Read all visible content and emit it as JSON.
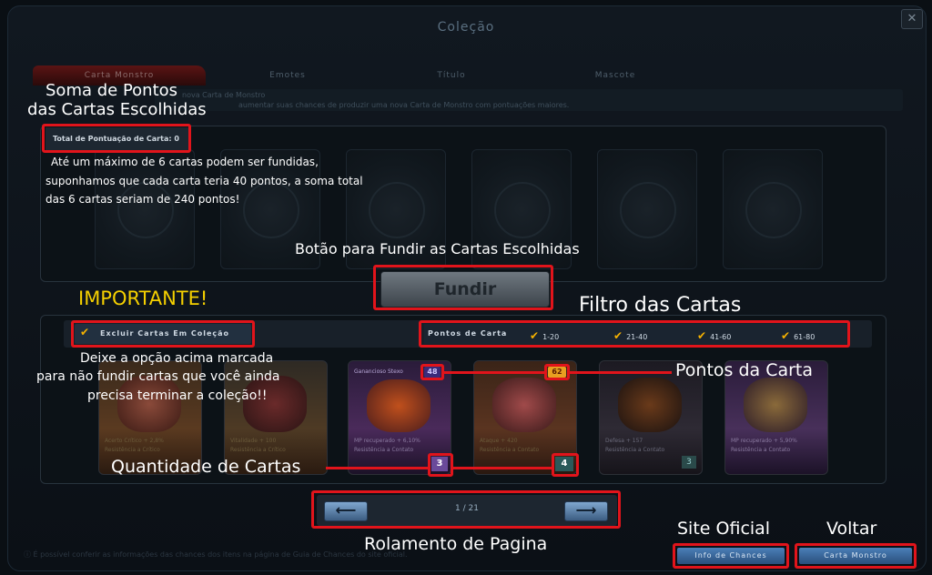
{
  "window": {
    "title": "Coleção"
  },
  "tabs": [
    "Carta Monstro",
    "Emotes",
    "Título",
    "Mascote"
  ],
  "info_strip": {
    "title": "nova Carta de Monstro",
    "text": "aumentar suas chances de produzir uma nova Carta de Monstro com pontuações maiores."
  },
  "score": {
    "label": "Total de Pontuação de Carta: 0"
  },
  "fuse_button": {
    "label": "Fundir"
  },
  "exclude_filter": {
    "label": "Excluir Cartas Em Coleção",
    "checked": true
  },
  "points_filter": {
    "label": "Pontos de Carta",
    "options": [
      {
        "label": "1-20",
        "checked": true
      },
      {
        "label": "21-40",
        "checked": true
      },
      {
        "label": "41-60",
        "checked": true
      },
      {
        "label": "61-80",
        "checked": true
      }
    ]
  },
  "cards": [
    {
      "name": "",
      "stat": "Acerto Crítico + 2,8%",
      "stat2": "Resistência a Crítico",
      "badge": "",
      "qty": ""
    },
    {
      "name": "",
      "stat": "Vitalidade + 100",
      "stat2": "Resistência a Crítico",
      "badge": "",
      "qty": ""
    },
    {
      "name": "Ganancioso Stexo",
      "stat": "MP recuperado + 6,10%",
      "stat2": "Resistência a Contato",
      "badge": "48",
      "qty": "3"
    },
    {
      "name": "",
      "stat": "Ataque + 420",
      "stat2": "Resistência a Contato",
      "badge": "62",
      "qty": "4"
    },
    {
      "name": "",
      "stat": "Defesa + 157",
      "stat2": "Resistência a Contato",
      "badge": "",
      "qty": "3"
    },
    {
      "name": "",
      "stat": "MP recuperado + 5,90%",
      "stat2": "Resistência a Contato",
      "badge": "",
      "qty": ""
    }
  ],
  "pagination": {
    "text": "1 / 21"
  },
  "footer_note": "É possível conferir as informações das chances dos itens na página de Guia de Chances do site oficial.",
  "bottom_buttons": {
    "chances": "Info de Chances",
    "back": "Carta Monstro"
  },
  "annotations": {
    "score_title_1": "Soma de Pontos",
    "score_title_2": "das Cartas Escolhidas",
    "max_info_1": "Até um máximo de 6 cartas podem ser fundidas,",
    "max_info_2": "suponhamos que cada carta teria 40 pontos, a soma total",
    "max_info_3": "das 6 cartas seriam de 240 pontos!",
    "fuse_hint": "Botão para Fundir as Cartas Escolhidas",
    "important": "IMPORTANTE!",
    "keep_1": "Deixe a opção acima marcada",
    "keep_2": "para não fundir cartas que você ainda",
    "keep_3": "precisa terminar a coleção!!",
    "filter_title": "Filtro das Cartas",
    "card_points": "Pontos da Carta",
    "card_qty": "Quantidade de Cartas",
    "page_scroll": "Rolamento de Pagina",
    "official_site": "Site Oficial",
    "back": "Voltar"
  },
  "colors": {
    "accent": "#e1141b",
    "important": "#f5d000",
    "check": "#f5b100",
    "button_blue": "#3a6a9c"
  }
}
